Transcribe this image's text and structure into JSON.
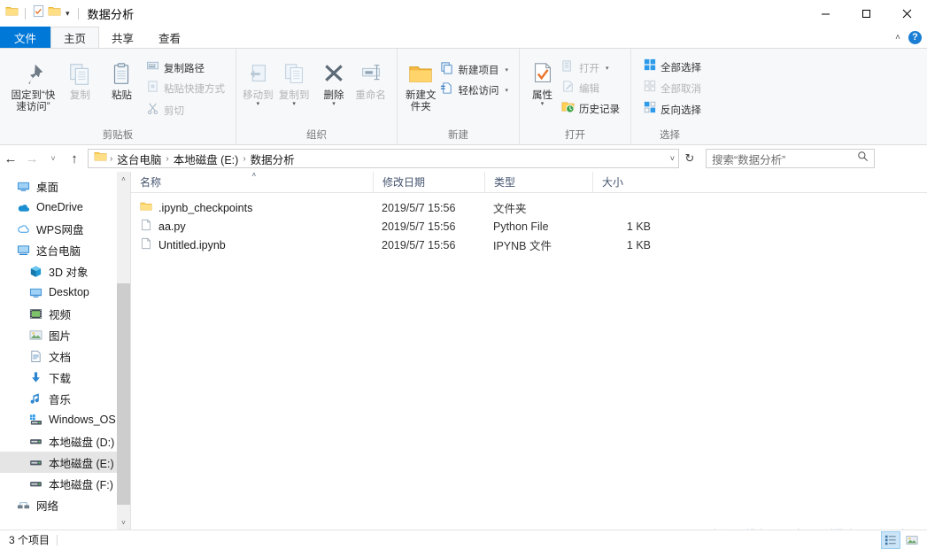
{
  "window": {
    "title": "数据分析",
    "quick_access": [
      {
        "name": "folder-icon",
        "label": "文件夹"
      },
      {
        "name": "properties-icon",
        "label": "属性"
      },
      {
        "name": "new-folder-icon",
        "label": "新建文件夹"
      },
      {
        "name": "chevron-down-icon",
        "label": "自定义快速访问工具栏"
      }
    ],
    "controls": {
      "minimize": "—",
      "maximize": "☐",
      "close": "✕"
    }
  },
  "tabs": [
    {
      "label": "文件",
      "id": "file"
    },
    {
      "label": "主页",
      "id": "home"
    },
    {
      "label": "共享",
      "id": "share"
    },
    {
      "label": "查看",
      "id": "view"
    }
  ],
  "tabstrip_right": {
    "collapse_label": "˄",
    "help_label": "?"
  },
  "ribbon": {
    "groups": [
      {
        "title": "剪贴板",
        "big": [
          {
            "label": "固定到“快速访问”",
            "icon": "pin-icon",
            "dim": false
          },
          {
            "label": "复制",
            "icon": "copy-icon",
            "dim": true
          },
          {
            "label": "粘贴",
            "icon": "paste-icon",
            "dim": false
          }
        ],
        "small": [
          {
            "label": "复制路径",
            "icon": "copy-path-icon",
            "dim": false
          },
          {
            "label": "粘贴快捷方式",
            "icon": "paste-shortcut-icon",
            "dim": true
          },
          {
            "label": "剪切",
            "icon": "cut-icon",
            "dim": true
          }
        ]
      },
      {
        "title": "组织",
        "big": [
          {
            "label": "移动到",
            "icon": "move-to-icon",
            "dim": true,
            "caret": true
          },
          {
            "label": "复制到",
            "icon": "copy-to-icon",
            "dim": true,
            "caret": true
          },
          {
            "label": "删除",
            "icon": "delete-icon",
            "dim": false,
            "caret": true
          },
          {
            "label": "重命名",
            "icon": "rename-icon",
            "dim": true
          }
        ],
        "small": []
      },
      {
        "title": "新建",
        "big": [
          {
            "label": "新建文件夹",
            "icon": "new-folder-large-icon",
            "dim": false
          }
        ],
        "small": [
          {
            "label": "新建项目",
            "icon": "new-item-icon",
            "dim": false,
            "caret": true
          },
          {
            "label": "轻松访问",
            "icon": "easy-access-icon",
            "dim": false,
            "caret": true
          }
        ]
      },
      {
        "title": "打开",
        "big": [
          {
            "label": "属性",
            "icon": "properties-large-icon",
            "dim": false,
            "caret": true
          }
        ],
        "small": [
          {
            "label": "打开",
            "icon": "open-icon",
            "dim": true,
            "caret": true
          },
          {
            "label": "编辑",
            "icon": "edit-icon",
            "dim": true
          },
          {
            "label": "历史记录",
            "icon": "history-icon",
            "dim": false
          }
        ]
      },
      {
        "title": "选择",
        "big": [],
        "small": [
          {
            "label": "全部选择",
            "icon": "select-all-icon",
            "dim": false
          },
          {
            "label": "全部取消",
            "icon": "select-none-icon",
            "dim": true
          },
          {
            "label": "反向选择",
            "icon": "invert-selection-icon",
            "dim": false
          }
        ]
      }
    ]
  },
  "address": {
    "back_icon": "←",
    "forward_icon": "→",
    "history_icon": "˅",
    "up_icon": "↑",
    "breadcrumbs": [
      "这台电脑",
      "本地磁盘 (E:)",
      "数据分析"
    ],
    "separator": "›",
    "dropdown_icon": "˅",
    "refresh_icon": "↻"
  },
  "search": {
    "placeholder": "搜索“数据分析”",
    "icon": "search-icon"
  },
  "navpane": {
    "items": [
      {
        "label": "桌面",
        "icon": "desktop-icon",
        "indent": false,
        "selected": false
      },
      {
        "label": "OneDrive",
        "icon": "onedrive-icon",
        "indent": false,
        "selected": false
      },
      {
        "label": "WPS网盘",
        "icon": "wps-cloud-icon",
        "indent": false,
        "selected": false
      },
      {
        "label": "这台电脑",
        "icon": "this-pc-icon",
        "indent": false,
        "selected": false
      },
      {
        "label": "3D 对象",
        "icon": "3d-objects-icon",
        "indent": true,
        "selected": false
      },
      {
        "label": "Desktop",
        "icon": "desktop-folder-icon",
        "indent": true,
        "selected": false
      },
      {
        "label": "视频",
        "icon": "videos-icon",
        "indent": true,
        "selected": false
      },
      {
        "label": "图片",
        "icon": "pictures-icon",
        "indent": true,
        "selected": false
      },
      {
        "label": "文档",
        "icon": "documents-icon",
        "indent": true,
        "selected": false
      },
      {
        "label": "下载",
        "icon": "downloads-icon",
        "indent": true,
        "selected": false
      },
      {
        "label": "音乐",
        "icon": "music-icon",
        "indent": true,
        "selected": false
      },
      {
        "label": "Windows_OS (C:)",
        "icon": "windows-drive-icon",
        "indent": true,
        "selected": false
      },
      {
        "label": "本地磁盘 (D:)",
        "icon": "drive-icon",
        "indent": true,
        "selected": false
      },
      {
        "label": "本地磁盘 (E:)",
        "icon": "drive-icon",
        "indent": true,
        "selected": true
      },
      {
        "label": "本地磁盘 (F:)",
        "icon": "drive-icon",
        "indent": true,
        "selected": false
      },
      {
        "label": "网络",
        "icon": "network-icon",
        "indent": false,
        "selected": false
      }
    ],
    "scroll_up_icon": "˄",
    "scroll_down_icon": "˅"
  },
  "filelist": {
    "columns": [
      {
        "label": "名称",
        "key": "name",
        "sorted": true
      },
      {
        "label": "修改日期",
        "key": "date",
        "sorted": false
      },
      {
        "label": "类型",
        "key": "type",
        "sorted": false
      },
      {
        "label": "大小",
        "key": "size",
        "sorted": false
      }
    ],
    "sort_indicator": "˄",
    "rows": [
      {
        "name": ".ipynb_checkpoints",
        "date": "2019/5/7 15:56",
        "type": "文件夹",
        "size": "",
        "icon": "folder-icon"
      },
      {
        "name": "aa.py",
        "date": "2019/5/7 15:56",
        "type": "Python File",
        "size": "1 KB",
        "icon": "file-icon"
      },
      {
        "name": "Untitled.ipynb",
        "date": "2019/5/7 15:56",
        "type": "IPYNB 文件",
        "size": "1 KB",
        "icon": "file-icon"
      }
    ]
  },
  "statusbar": {
    "item_count": "3 个项目",
    "view_buttons": [
      {
        "name": "details-view-button",
        "active": true
      },
      {
        "name": "large-icons-view-button",
        "active": false
      }
    ]
  },
  "watermark": {
    "text": "https://blog.csdn.net/ITxiaoangzai"
  },
  "colors": {
    "accent": "#0078d7",
    "ribbon_bg": "#f7f8fa",
    "selection": "#e5e5e5",
    "folder_yellow": "#ffd155",
    "column_header": "#44546f",
    "watermark": "#cfe0ef"
  }
}
